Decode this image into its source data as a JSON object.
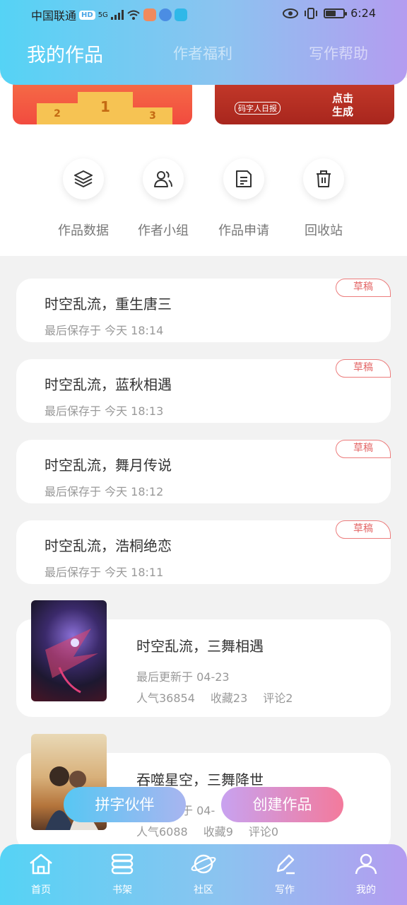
{
  "status_bar": {
    "carrier": "中国联通",
    "hd": "HD",
    "network": "5G",
    "time": "6:24",
    "battery_level": 0.6
  },
  "header": {
    "tabs": [
      {
        "label": "我的作品",
        "active": true
      },
      {
        "label": "作者福利",
        "active": false
      },
      {
        "label": "写作帮助",
        "active": false
      }
    ]
  },
  "banners": {
    "right_button": "点击生成",
    "right_small": "码字人日报"
  },
  "quick_actions": [
    {
      "label": "作品数据",
      "icon": "layers-icon"
    },
    {
      "label": "作者小组",
      "icon": "group-icon"
    },
    {
      "label": "作品申请",
      "icon": "document-icon"
    },
    {
      "label": "回收站",
      "icon": "trash-icon"
    }
  ],
  "drafts": [
    {
      "title": "时空乱流，重生唐三",
      "meta": "最后保存于 今天 18:14",
      "tag": "草稿"
    },
    {
      "title": "时空乱流，蓝秋相遇",
      "meta": "最后保存于 今天 18:13",
      "tag": "草稿"
    },
    {
      "title": "时空乱流，舞月传说",
      "meta": "最后保存于 今天 18:12",
      "tag": "草稿"
    },
    {
      "title": "时空乱流，浩桐绝恋",
      "meta": "最后保存于 今天 18:11",
      "tag": "草稿"
    }
  ],
  "books": [
    {
      "title": "时空乱流，三舞相遇",
      "meta": "最后更新于 04-23",
      "popularity": "人气36854",
      "favorites": "收藏23",
      "comments": "评论2"
    },
    {
      "title": "吞噬星空，三舞降世",
      "meta": "最后更新于 04-",
      "popularity": "人气6088",
      "favorites": "收藏9",
      "comments": "评论0"
    }
  ],
  "floating_buttons": {
    "partner": "拼字伙伴",
    "create": "创建作品"
  },
  "bottom_nav": [
    {
      "label": "首页",
      "icon": "home-icon"
    },
    {
      "label": "书架",
      "icon": "bookshelf-icon"
    },
    {
      "label": "社区",
      "icon": "planet-icon"
    },
    {
      "label": "写作",
      "icon": "pen-icon",
      "active": true
    },
    {
      "label": "我的",
      "icon": "user-icon"
    }
  ]
}
